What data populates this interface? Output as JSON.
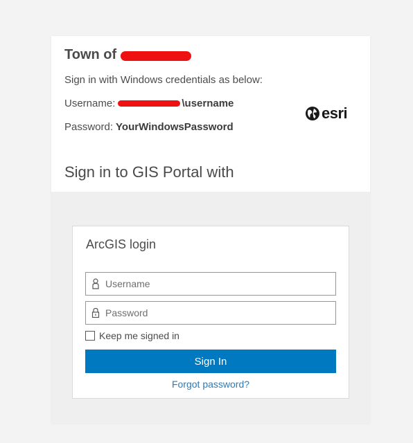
{
  "header": {
    "title": "Town of",
    "instructions": "Sign in with Windows credentials as below:",
    "username_label": "Username:",
    "username_value": "\\username",
    "password_label": "Password:",
    "password_value": "YourWindowsPassword",
    "logo_text": "esri",
    "portal_title": "Sign in to GIS Portal with"
  },
  "login": {
    "heading": "ArcGIS login",
    "username_placeholder": "Username",
    "password_placeholder": "Password",
    "keep_signed_in": "Keep me signed in",
    "sign_in_label": "Sign In",
    "forgot_label": "Forgot password?"
  },
  "icons": {
    "logo": "globe-icon",
    "username": "user-icon",
    "password": "lock-icon"
  },
  "colors": {
    "primary": "#0079c1",
    "link": "#2b7bb9",
    "redaction": "#ee1111"
  }
}
